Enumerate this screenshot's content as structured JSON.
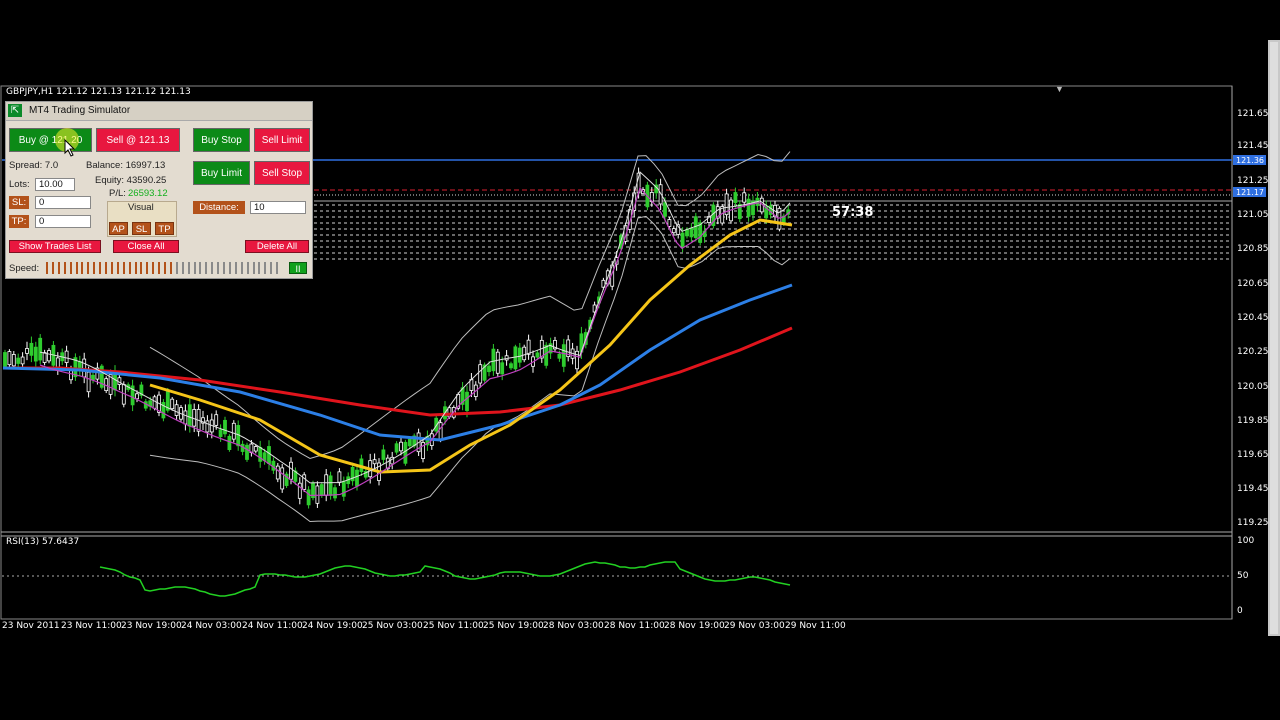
{
  "chart": {
    "symbol_header": "GBPJPY,H1  121.12 121.13 121.12 121.13",
    "countdown": "57:38",
    "indicator_label": "RSI(13) 57.6437",
    "price_labels": [
      "121.65",
      "121.45",
      "121.25",
      "121.05",
      "120.85",
      "120.65",
      "120.45",
      "120.25",
      "120.05",
      "119.85",
      "119.65",
      "119.45",
      "119.25"
    ],
    "highlight_prices": {
      "blue": "121.36",
      "red": "121.17"
    },
    "rsi_levels": [
      "100",
      "50",
      "0"
    ],
    "time_labels": [
      "23 Nov 2011",
      "23 Nov 11:00",
      "23 Nov 19:00",
      "24 Nov 03:00",
      "24 Nov 11:00",
      "24 Nov 19:00",
      "25 Nov 03:00",
      "25 Nov 11:00",
      "25 Nov 19:00",
      "28 Nov 03:00",
      "28 Nov 11:00",
      "28 Nov 19:00",
      "29 Nov 03:00",
      "29 Nov 11:00"
    ],
    "colors": {
      "background": "#000000",
      "bull_candle": "#ffffff",
      "bear_candle": "#2ecc2e",
      "ma_red": "#e0141c",
      "ma_blue": "#2c7fe6",
      "ma_yellow": "#f5c518",
      "rsi": "#22d022"
    }
  },
  "panel": {
    "title": "MT4 Trading Simulator",
    "buy_label": "Buy @ 121.20",
    "sell_label": "Sell @ 121.13",
    "buy_stop": "Buy Stop",
    "sell_limit": "Sell Limit",
    "buy_limit": "Buy Limit",
    "sell_stop": "Sell Stop",
    "spread": "Spread: 7.0",
    "balance": "Balance: 16997.13",
    "equity": "Equity: 43590.25",
    "pl_label": "P/L:",
    "pl_value": "26593.12",
    "lots_label": "Lots:",
    "lots_value": "10.00",
    "sl_label": "SL:",
    "sl_value": "0",
    "tp_label": "TP:",
    "tp_value": "0",
    "visual_label": "Visual",
    "visual_ap": "AP",
    "visual_sl": "SL",
    "visual_tp": "TP",
    "distance_label": "Distance:",
    "distance_value": "10",
    "show_trades": "Show Trades List",
    "close_all": "Close All",
    "delete_all": "Delete All",
    "speed_label": "Speed:",
    "pause_label": "II",
    "speed_fraction": 0.54
  }
}
